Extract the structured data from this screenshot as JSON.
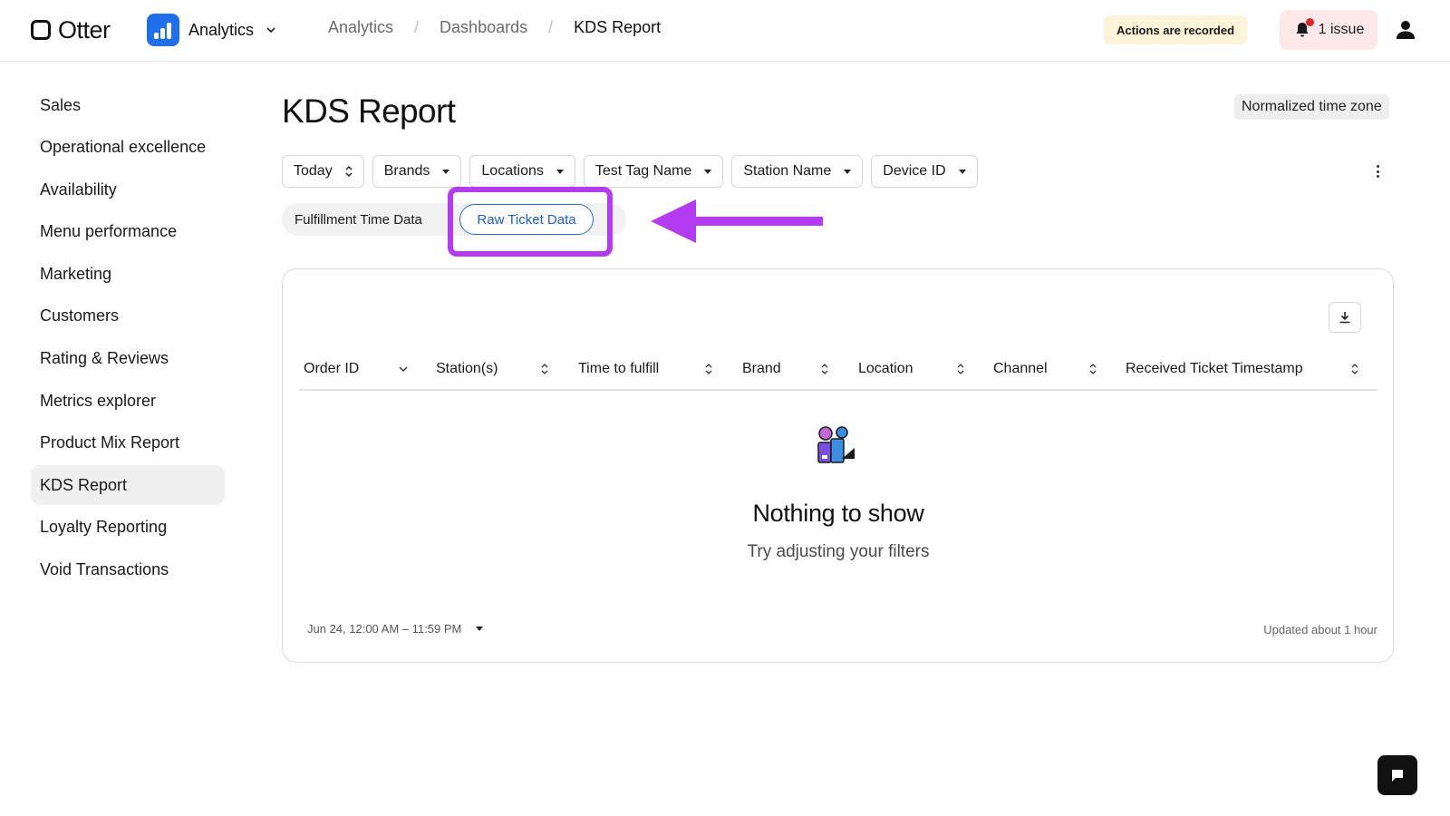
{
  "header": {
    "logo_text": "Otter",
    "app_name": "Analytics",
    "breadcrumb": [
      "Analytics",
      "Dashboards",
      "KDS Report"
    ],
    "breadcrumb_sep": "/",
    "recorded_badge": "Actions are recorded",
    "issues_label": "1 issue",
    "colors": {
      "brand": "#1f6feb",
      "alert": "#e0242b",
      "issue_bg": "#fde9ea",
      "recorded_bg": "#fdf3d9"
    }
  },
  "sidebar": {
    "items": [
      {
        "label": "Sales"
      },
      {
        "label": "Operational excellence"
      },
      {
        "label": "Availability"
      },
      {
        "label": "Menu performance"
      },
      {
        "label": "Marketing"
      },
      {
        "label": "Customers"
      },
      {
        "label": "Rating & Reviews"
      },
      {
        "label": "Metrics explorer"
      },
      {
        "label": "Product Mix Report"
      },
      {
        "label": "KDS Report",
        "active": true
      },
      {
        "label": "Loyalty Reporting"
      },
      {
        "label": "Void Transactions"
      }
    ]
  },
  "main": {
    "title": "KDS Report",
    "timezone_badge": "Normalized time zone",
    "filters": [
      {
        "label": "Today",
        "icon": "sort-updown-icon"
      },
      {
        "label": "Brands",
        "icon": "caret-down-icon"
      },
      {
        "label": "Locations",
        "icon": "caret-down-icon"
      },
      {
        "label": "Test Tag Name",
        "icon": "caret-down-icon"
      },
      {
        "label": "Station Name",
        "icon": "caret-down-icon"
      },
      {
        "label": "Device ID",
        "icon": "caret-down-icon"
      }
    ],
    "tabs": [
      {
        "label": "Fulfillment Time Data",
        "selected": false
      },
      {
        "label": "Raw Ticket Data",
        "selected": true
      }
    ],
    "annotation_color": "#b43cf0",
    "table": {
      "columns": [
        {
          "label": "Order ID",
          "sort": "desc"
        },
        {
          "label": "Station(s)",
          "sort": "none"
        },
        {
          "label": "Time to fulfill",
          "sort": "none"
        },
        {
          "label": "Brand",
          "sort": "none"
        },
        {
          "label": "Location",
          "sort": "none"
        },
        {
          "label": "Channel",
          "sort": "none"
        },
        {
          "label": "Received Ticket Timestamp",
          "sort": "none"
        }
      ],
      "rows": []
    },
    "empty_state": {
      "title": "Nothing to show",
      "subtitle": "Try adjusting your filters"
    },
    "footer": {
      "date_range": "Jun 24, 12:00 AM – 11:59 PM",
      "updated": "Updated about 1 hour"
    }
  }
}
